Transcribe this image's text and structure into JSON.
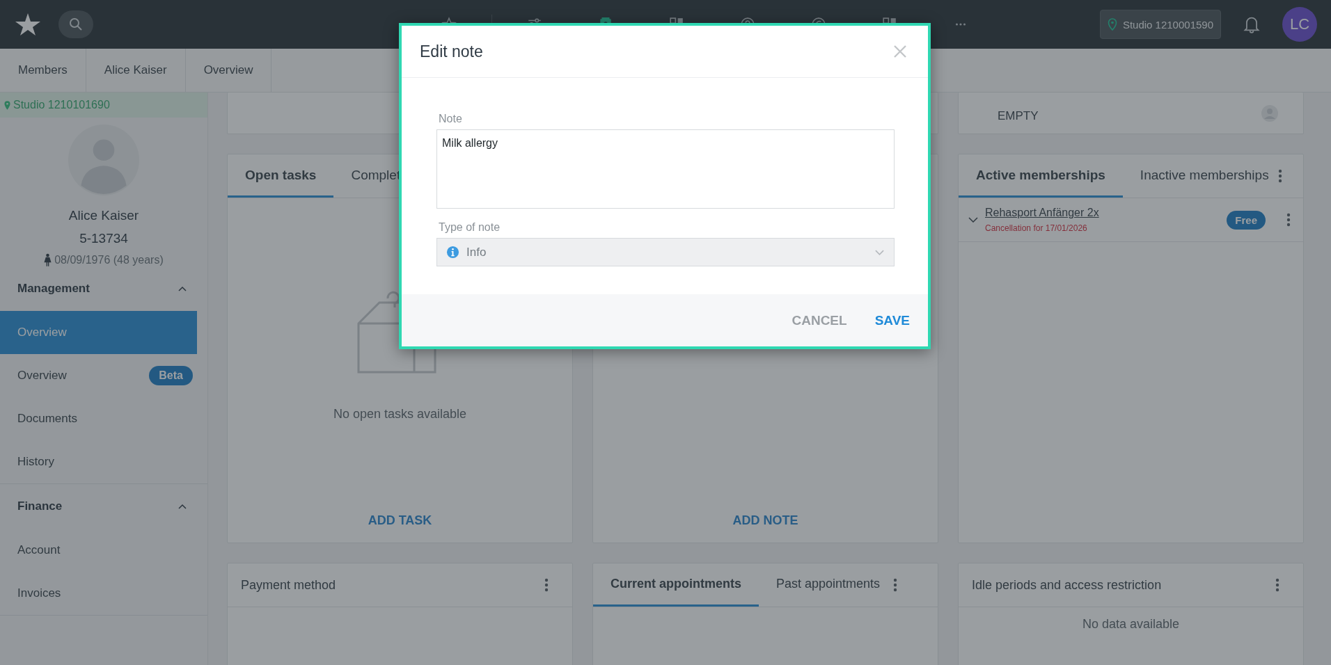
{
  "topbar": {
    "studio": "Studio 1210001590",
    "avatar": "LC"
  },
  "breadcrumbs": [
    "Members",
    "Alice Kaiser",
    "Overview"
  ],
  "sidebar": {
    "studio": "Studio 1210101690",
    "name": "Alice Kaiser",
    "member_number": "5-13734",
    "birth": "08/09/1976 (48 years)",
    "sections": [
      {
        "title": "Management",
        "expanded": true,
        "items": [
          {
            "label": "Overview",
            "selected": true
          },
          {
            "label": "Overview",
            "selected": false,
            "badge": "Beta"
          },
          {
            "label": "Documents",
            "selected": false
          },
          {
            "label": "History",
            "selected": false
          }
        ]
      },
      {
        "title": "Finance",
        "expanded": true,
        "items": [
          {
            "label": "Account",
            "selected": false
          },
          {
            "label": "Invoices",
            "selected": false
          }
        ]
      }
    ]
  },
  "tasks_card": {
    "tabs": [
      {
        "label": "Open tasks",
        "selected": true
      },
      {
        "label": "Complet",
        "selected": false
      }
    ],
    "empty_text": "No open tasks available",
    "action": "ADD TASK"
  },
  "notes_card": {
    "action": "ADD NOTE"
  },
  "info_card": {
    "value": "EMPTY"
  },
  "memberships_card": {
    "tabs": [
      {
        "label": "Active memberships",
        "selected": true
      },
      {
        "label": "Inactive memberships",
        "selected": false
      }
    ],
    "items": [
      {
        "name": "Rehasport Anfänger 2x",
        "status": "Cancellation for 17/01/2026",
        "badge": "Free"
      }
    ]
  },
  "payment_card": {
    "title": "Payment method"
  },
  "appointments_card": {
    "tabs": [
      {
        "label": "Current appointments",
        "selected": true
      },
      {
        "label": "Past appointments",
        "selected": false
      }
    ]
  },
  "idle_card": {
    "title": "Idle periods and access restriction",
    "empty_text": "No data available"
  },
  "dialog": {
    "title": "Edit note",
    "fields": [
      {
        "label": "Note",
        "kind": "textarea",
        "value": "Milk allergy"
      },
      {
        "label": "Type of note",
        "kind": "select",
        "value": "Info",
        "disabled": true
      }
    ],
    "buttons": [
      {
        "label": "CANCEL",
        "kind": "secondary"
      },
      {
        "label": "SAVE",
        "kind": "primary"
      }
    ]
  }
}
